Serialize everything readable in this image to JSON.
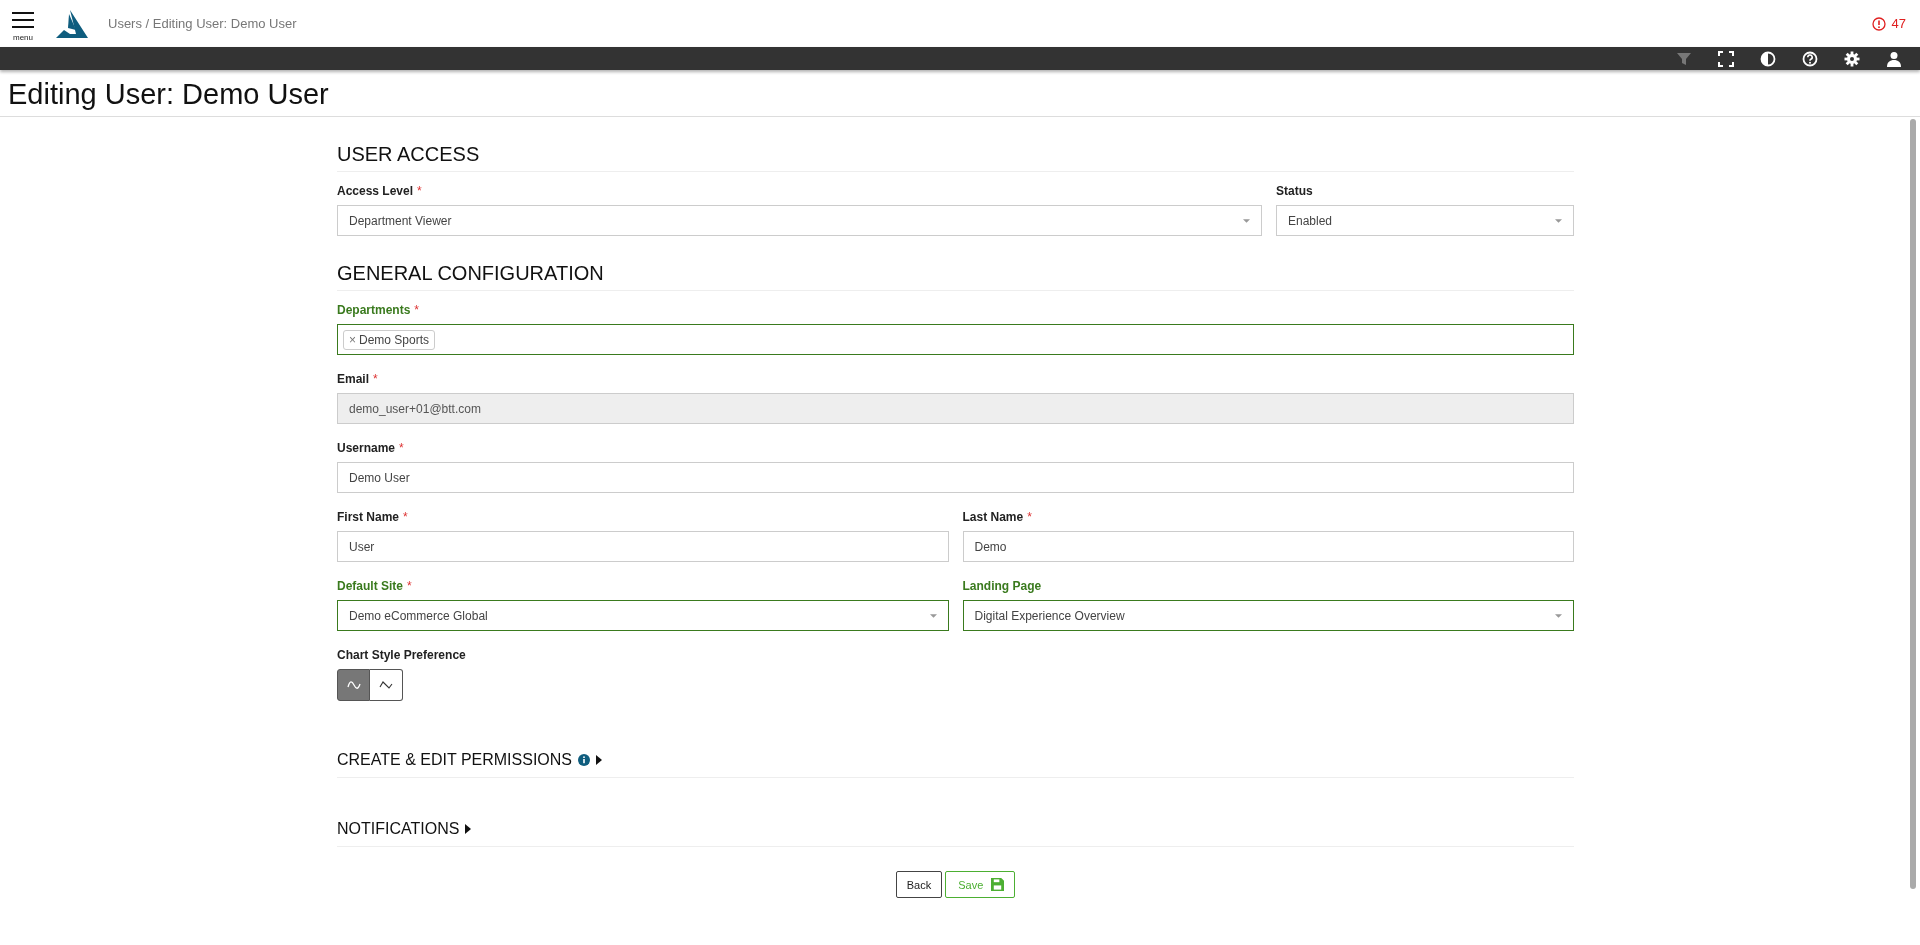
{
  "header": {
    "menu_label": "menu",
    "breadcrumb": "Users / Editing User: Demo User",
    "alert_count": "47"
  },
  "page_title": "Editing User: Demo User",
  "sections": [
    {
      "title": "USER ACCESS",
      "rows": [
        [
          {
            "kind": "select",
            "label": "Access Level",
            "marker": "*",
            "highlighted": false,
            "value": "Department Viewer"
          },
          {
            "kind": "select",
            "label": "Status",
            "highlighted": false,
            "value": "Enabled"
          }
        ]
      ]
    },
    {
      "title": "GENERAL CONFIGURATION",
      "rows": [
        [
          {
            "kind": "tags",
            "label": "Departments",
            "marker": "*",
            "highlighted": true,
            "tags": [
              {
                "remove": "×",
                "label": "Demo Sports"
              }
            ]
          }
        ],
        [
          {
            "kind": "text",
            "label": "Email",
            "marker": "*",
            "highlighted": false,
            "disabled": true,
            "value": "demo_user+01@btt.com"
          }
        ],
        [
          {
            "kind": "text",
            "label": "Username",
            "marker": "*",
            "highlighted": false,
            "disabled": false,
            "value": "Demo User"
          }
        ],
        [
          {
            "kind": "text",
            "label": "First Name",
            "marker": "*",
            "highlighted": false,
            "disabled": false,
            "value": "User"
          },
          {
            "kind": "text",
            "label": "Last Name",
            "marker": "*",
            "highlighted": false,
            "disabled": false,
            "value": "Demo"
          }
        ],
        [
          {
            "kind": "select",
            "label": "Default Site",
            "marker": "*",
            "highlighted": true,
            "value": "Demo eCommerce Global"
          },
          {
            "kind": "select",
            "label": "Landing Page",
            "highlighted": true,
            "value": "Digital Experience Overview"
          }
        ],
        [
          {
            "kind": "toggle",
            "label": "Chart Style Preference",
            "highlighted": false,
            "options": [
              {
                "selected": true
              },
              {
                "selected": false
              }
            ]
          }
        ]
      ]
    }
  ],
  "collapsibles": [
    {
      "title": "CREATE & EDIT PERMISSIONS",
      "info": true,
      "expanded": false
    },
    {
      "title": "NOTIFICATIONS",
      "info": false,
      "expanded": false
    }
  ],
  "buttons": [
    {
      "kind": "back",
      "label": "Back"
    },
    {
      "kind": "save",
      "label": "Save"
    }
  ]
}
